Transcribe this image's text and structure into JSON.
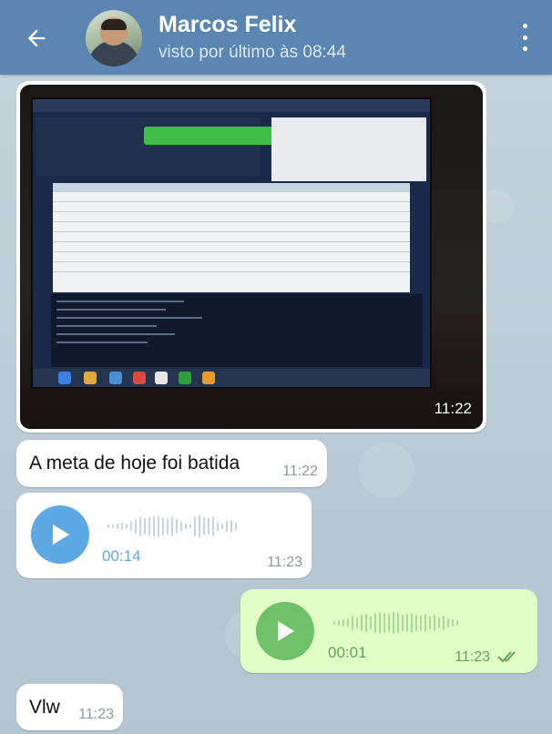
{
  "header": {
    "contact_name": "Marcos Felix",
    "last_seen": "visto por último às 08:44"
  },
  "colors": {
    "header": "#5a86b1",
    "incoming_bubble": "#ffffff",
    "outgoing_bubble": "#e1fec6",
    "incoming_play": "#5ea9e3",
    "outgoing_play": "#6fc16a"
  },
  "icons": {
    "back": "arrow-left-icon",
    "menu": "more-vertical-icon",
    "play": "play-icon",
    "read": "double-check-icon"
  },
  "messages": [
    {
      "type": "photo",
      "direction": "incoming",
      "time": "11:22"
    },
    {
      "type": "text",
      "direction": "incoming",
      "text": "A meta de hoje foi batida",
      "time": "11:22"
    },
    {
      "type": "voice",
      "direction": "incoming",
      "duration": "00:14",
      "time": "11:23"
    },
    {
      "type": "voice",
      "direction": "outgoing",
      "duration": "00:01",
      "time": "11:23",
      "status": "read"
    },
    {
      "type": "text",
      "direction": "incoming",
      "text": "Vlw",
      "time": "11:23"
    }
  ]
}
